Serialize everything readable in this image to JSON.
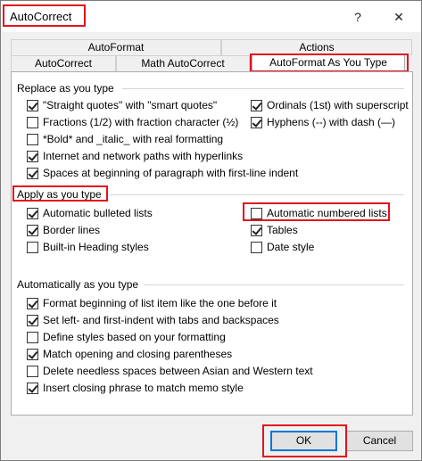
{
  "title": "AutoCorrect",
  "titlebar": {
    "help_label": "?",
    "close_label": "✕"
  },
  "tabs": {
    "row1": [
      "AutoFormat",
      "Actions"
    ],
    "row2": [
      "AutoCorrect",
      "Math AutoCorrect",
      "AutoFormat As You Type"
    ],
    "active": "AutoFormat As You Type"
  },
  "replace_section": {
    "label": "Replace as you type",
    "left": [
      {
        "label": "\"Straight quotes\" with \"smart quotes\"",
        "checked": true
      },
      {
        "label": "Fractions (1/2) with fraction character (½)",
        "checked": false
      },
      {
        "label": "*Bold* and _italic_ with real formatting",
        "checked": false
      },
      {
        "label": "Internet and network paths with hyperlinks",
        "checked": true
      },
      {
        "label": "Spaces at beginning of paragraph with first-line indent",
        "checked": true
      }
    ],
    "right": [
      {
        "label": "Ordinals (1st) with superscript",
        "checked": true
      },
      {
        "label": "Hyphens (--) with dash (—)",
        "checked": true
      }
    ]
  },
  "apply_section": {
    "label": "Apply as you type",
    "left": [
      {
        "label": "Automatic bulleted lists",
        "checked": true
      },
      {
        "label": "Border lines",
        "checked": true
      },
      {
        "label": "Built-in Heading styles",
        "checked": false
      }
    ],
    "right": [
      {
        "label": "Automatic numbered lists",
        "checked": false
      },
      {
        "label": "Tables",
        "checked": true
      },
      {
        "label": "Date style",
        "checked": false
      }
    ]
  },
  "auto_section": {
    "label": "Automatically as you type",
    "items": [
      {
        "label": "Format beginning of list item like the one before it",
        "checked": true
      },
      {
        "label": "Set left- and first-indent with tabs and backspaces",
        "checked": true
      },
      {
        "label": "Define styles based on your formatting",
        "checked": false
      },
      {
        "label": "Match opening and closing parentheses",
        "checked": true
      },
      {
        "label": "Delete needless spaces between Asian and Western text",
        "checked": false
      },
      {
        "label": "Insert closing phrase to match memo style",
        "checked": true
      }
    ]
  },
  "buttons": {
    "ok_label": "OK",
    "cancel_label": "Cancel"
  },
  "highlight_color": "#e0141e",
  "accent_color": "#0078d7"
}
